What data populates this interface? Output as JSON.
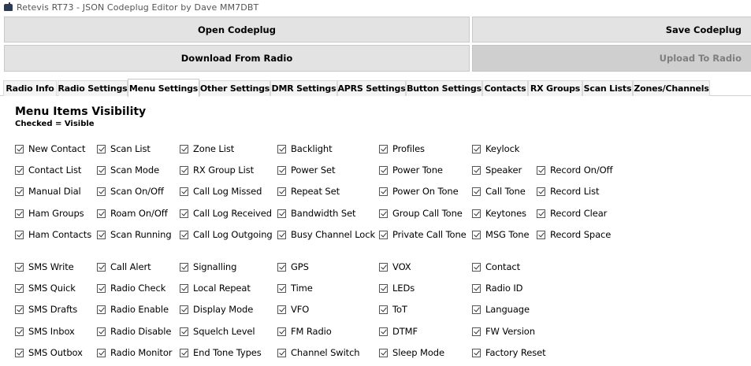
{
  "window": {
    "title": "Retevis RT73 - JSON Codeplug Editor by Dave MM7DBT"
  },
  "buttons": {
    "open": "Open Codeplug",
    "save": "Save Codeplug",
    "download": "Download From Radio",
    "upload": "Upload To Radio"
  },
  "tabs": [
    "Radio Info",
    "Radio Settings",
    "Menu Settings",
    "Other Settings",
    "DMR Settings",
    "APRS Settings",
    "Button Settings",
    "Contacts",
    "RX Groups",
    "Scan Lists",
    "Zones/Channels"
  ],
  "active_tab": "Menu Settings",
  "panel": {
    "heading": "Menu Items Visibility",
    "subheading": "Checked = Visible"
  },
  "groups": [
    {
      "columns": [
        [
          "New Contact",
          "Contact List",
          "Manual Dial",
          "Ham Groups",
          "Ham Contacts"
        ],
        [
          "Scan List",
          "Scan Mode",
          "Scan On/Off",
          "Roam On/Off",
          "Scan Running"
        ],
        [
          "Zone List",
          "RX Group List",
          "Call Log Missed",
          "Call Log Received",
          "Call Log Outgoing"
        ],
        [
          "Backlight",
          "Power Set",
          "Repeat Set",
          "Bandwidth Set",
          "Busy Channel Lock"
        ],
        [
          "Profiles",
          "Power Tone",
          "Power On Tone",
          "Group Call Tone",
          "Private Call Tone"
        ],
        [
          "Keylock",
          "Speaker",
          "Call Tone",
          "Keytones",
          "MSG Tone"
        ],
        [
          "",
          "Record On/Off",
          "Record List",
          "Record Clear",
          "Record Space"
        ]
      ]
    },
    {
      "columns": [
        [
          "SMS Write",
          "SMS Quick",
          "SMS Drafts",
          "SMS Inbox",
          "SMS Outbox"
        ],
        [
          "Call Alert",
          "Radio Check",
          "Radio Enable",
          "Radio Disable",
          "Radio Monitor"
        ],
        [
          "Signalling",
          "Local Repeat",
          "Display Mode",
          "Squelch Level",
          "End Tone Types"
        ],
        [
          "GPS",
          "Time",
          "VFO",
          "FM Radio",
          "Channel Switch"
        ],
        [
          "VOX",
          "LEDs",
          "ToT",
          "DTMF",
          "Sleep Mode"
        ],
        [
          "Contact",
          "Radio ID",
          "Language",
          "FW Version",
          "Factory Reset"
        ]
      ]
    }
  ]
}
